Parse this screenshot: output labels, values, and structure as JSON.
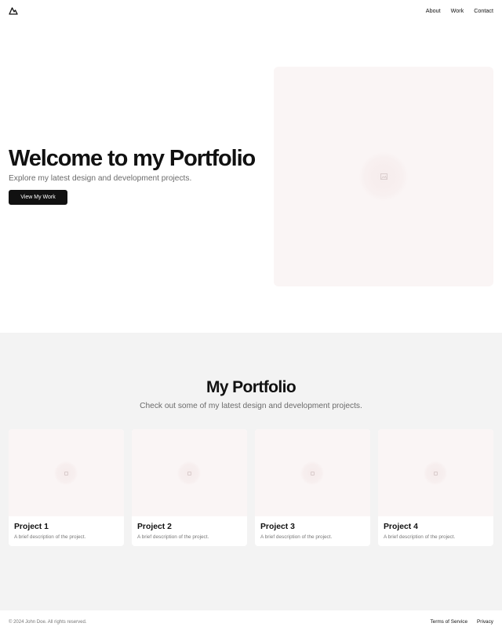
{
  "nav": {
    "logo_icon": "mountain-icon",
    "links": [
      "About",
      "Work",
      "Contact"
    ]
  },
  "hero": {
    "title": "Welcome to my Portfolio",
    "subtitle": "Explore my latest design and development projects.",
    "button": "View My Work",
    "image_icon": "image-icon"
  },
  "portfolio": {
    "title": "My Portfolio",
    "subtitle": "Check out some of my latest design and development projects.",
    "projects": [
      {
        "title": "Project 1",
        "desc": "A brief description of the project."
      },
      {
        "title": "Project 2",
        "desc": "A brief description of the project."
      },
      {
        "title": "Project 3",
        "desc": "A brief description of the project."
      },
      {
        "title": "Project 4",
        "desc": "A brief description of the project."
      }
    ]
  },
  "footer": {
    "copyright": "© 2024 John Doe. All rights reserved.",
    "links": [
      "Terms of Service",
      "Privacy"
    ]
  },
  "colors": {
    "accent": "#111111",
    "muted_text": "#6b6b6b",
    "placeholder_bg": "#faf5f5",
    "section_bg": "#f3f3f3"
  }
}
